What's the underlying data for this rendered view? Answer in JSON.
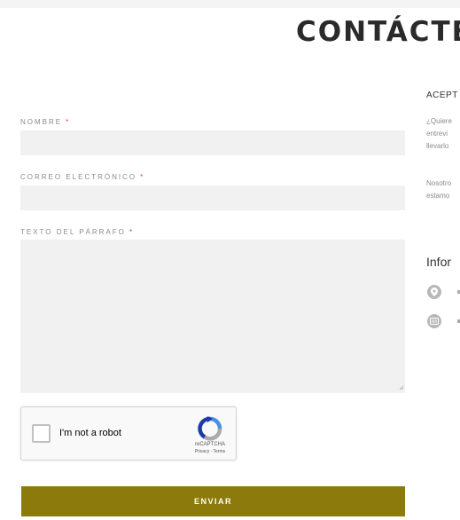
{
  "page": {
    "title": "CONTÁCTE"
  },
  "form": {
    "name_label": "NOMBRE",
    "name_value": "",
    "email_label": "CORREO ELECTRÓNICO",
    "email_value": "",
    "message_label": "TEXTO DEL PÁRRAFO",
    "message_value": "",
    "required_mark": "*",
    "submit_label": "ENVIAR"
  },
  "recaptcha": {
    "checkbox_label": "I'm not a robot",
    "brand": "reCAPTCHA",
    "links": "Privacy - Terms",
    "checked": false
  },
  "sidebar": {
    "heading": "ACEPT",
    "paragraph1": [
      "¿Quiere",
      "entrevi",
      "llevarlo"
    ],
    "paragraph2": [
      "Nosotro",
      "estamo"
    ],
    "info_title": "Infor",
    "info_items": [
      {
        "icon": "map-pin-icon"
      },
      {
        "icon": "envelope-icon"
      }
    ]
  },
  "colors": {
    "accent": "#8c7a0c",
    "field_bg": "#f1f1f1",
    "required": "#d23a3a",
    "title": "#2a2a2a"
  }
}
